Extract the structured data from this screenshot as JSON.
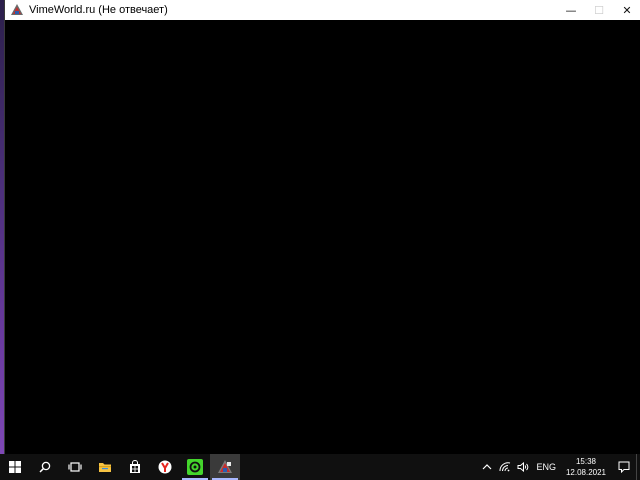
{
  "window": {
    "title": "VimeWorld.ru (Не отвечает)",
    "controls": {
      "minimize": "—",
      "maximize": "☐",
      "close": "✕"
    }
  },
  "taskbar": {
    "items": [
      {
        "name": "start",
        "icon": "windows-icon"
      },
      {
        "name": "search",
        "icon": "search-icon"
      },
      {
        "name": "task-view",
        "icon": "task-view-icon"
      },
      {
        "name": "file-explorer",
        "icon": "folder-icon"
      },
      {
        "name": "microsoft-store",
        "icon": "store-icon"
      },
      {
        "name": "yandex-browser",
        "icon": "yandex-icon"
      },
      {
        "name": "razer",
        "icon": "razer-icon"
      },
      {
        "name": "vimeworld",
        "icon": "vimeworld-icon"
      }
    ],
    "tray": {
      "language": "ENG",
      "time": "15:38",
      "date": "12.08.2021"
    }
  },
  "colors": {
    "taskbar_bg": "#101010",
    "accent_underline": "#a9b8ff",
    "yandex_red": "#e52620",
    "razer_green": "#44d62c",
    "folder_yellow": "#f6c343"
  }
}
